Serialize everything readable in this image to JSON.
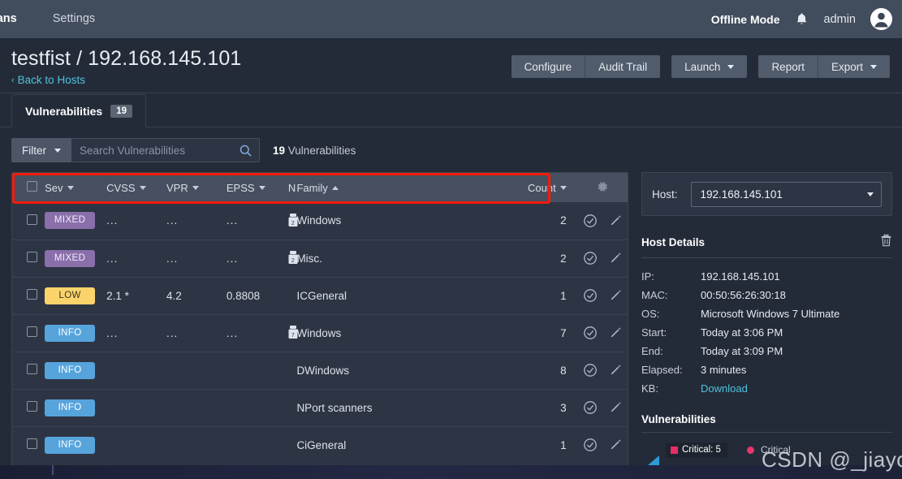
{
  "topnav": {
    "items": [
      {
        "label": "Scans",
        "active": true
      },
      {
        "label": "Settings",
        "active": false
      }
    ],
    "offline_mode": "Offline Mode",
    "bell_icon": "bell-icon",
    "user_name": "admin",
    "avatar_icon": "user-avatar-icon"
  },
  "header": {
    "title": "testfist / 192.168.145.101",
    "back_chevron": "‹",
    "back_link": "Back to Hosts",
    "buttons": {
      "configure": "Configure",
      "audit_trail": "Audit Trail",
      "launch": "Launch",
      "report": "Report",
      "export": "Export"
    }
  },
  "tabs": [
    {
      "label": "Vulnerabilities",
      "count": "19",
      "active": true
    }
  ],
  "filterbar": {
    "filter_label": "Filter",
    "search_placeholder": "Search Vulnerabilities",
    "search_value": "",
    "search_icon": "search-icon",
    "count_number": "19",
    "count_label": "Vulnerabilities"
  },
  "table": {
    "columns": [
      {
        "key": "checkbox",
        "label": "",
        "sort": ""
      },
      {
        "key": "sev",
        "label": "Sev",
        "sort": "desc"
      },
      {
        "key": "cvss",
        "label": "CVSS",
        "sort": "desc"
      },
      {
        "key": "vpr",
        "label": "VPR",
        "sort": "desc"
      },
      {
        "key": "epss",
        "label": "EPSS",
        "sort": "desc"
      },
      {
        "key": "name",
        "label": "N",
        "sort": ""
      },
      {
        "key": "family",
        "label": "Family",
        "sort": "asc"
      },
      {
        "key": "count",
        "label": "Count",
        "sort": "desc"
      },
      {
        "key": "gear",
        "label": "",
        "sort": ""
      }
    ],
    "gear_icon": "gear-icon",
    "rows": [
      {
        "sev": "MIXED",
        "sev_class": "mixed",
        "cvss": "...",
        "vpr": "...",
        "epss": "...",
        "name_badge": "2",
        "family": "Windows",
        "count": "2"
      },
      {
        "sev": "MIXED",
        "sev_class": "mixed",
        "cvss": "...",
        "vpr": "...",
        "epss": "...",
        "name_badge": "2",
        "family": "Misc.",
        "count": "2"
      },
      {
        "sev": "LOW",
        "sev_class": "low",
        "cvss": "2.1 *",
        "vpr": "4.2",
        "epss": "0.8808",
        "name_badge": "",
        "family": "ICGeneral",
        "count": "1"
      },
      {
        "sev": "INFO",
        "sev_class": "info",
        "cvss": "...",
        "vpr": "...",
        "epss": "...",
        "name_badge": "7",
        "family": "Windows",
        "count": "7"
      },
      {
        "sev": "INFO",
        "sev_class": "info",
        "cvss": "",
        "vpr": "",
        "epss": "",
        "name_badge": "",
        "family": "DWindows",
        "count": "8"
      },
      {
        "sev": "INFO",
        "sev_class": "info",
        "cvss": "",
        "vpr": "",
        "epss": "",
        "name_badge": "",
        "family": "NPort scanners",
        "count": "3"
      },
      {
        "sev": "INFO",
        "sev_class": "info",
        "cvss": "",
        "vpr": "",
        "epss": "",
        "name_badge": "",
        "family": "CiGeneral",
        "count": "1"
      }
    ],
    "row_action_icons": [
      "check-circle-icon",
      "pencil-icon"
    ]
  },
  "sidebar": {
    "host_label": "Host:",
    "host_value": "192.168.145.101",
    "host_dropdown_icon": "chevron-down-icon",
    "host_details_title": "Host Details",
    "trash_icon": "trash-icon",
    "details": [
      {
        "key": "IP:",
        "value": "192.168.145.101",
        "link": false
      },
      {
        "key": "MAC:",
        "value": "00:50:56:26:30:18",
        "link": false
      },
      {
        "key": "OS:",
        "value": "Microsoft Windows 7 Ultimate",
        "link": false
      },
      {
        "key": "Start:",
        "value": "Today at 3:06 PM",
        "link": false
      },
      {
        "key": "End:",
        "value": "Today at 3:09 PM",
        "link": false
      },
      {
        "key": "Elapsed:",
        "value": "3 minutes",
        "link": false
      },
      {
        "key": "KB:",
        "value": "Download",
        "link": true
      }
    ],
    "vulnerabilities_title": "Vulnerabilities",
    "chart_tooltip": "Critical: 5",
    "legend_label": "Critical"
  },
  "watermark": "CSDN @_jiayou",
  "chart_data": {
    "type": "pie",
    "title": "Vulnerabilities",
    "categories": [
      "Critical"
    ],
    "values": [
      5
    ],
    "labels": [
      "Critical: 5"
    ],
    "colors": [
      "#ec2b63"
    ],
    "legend_position": "right"
  },
  "colors": {
    "accent_link": "#4ec3e0",
    "severity_mixed": "#8a6fab",
    "severity_low": "#fad46b",
    "severity_info": "#57a4dc",
    "annotation_red": "#f41a0c",
    "critical": "#ec2b63",
    "page_bg": "#242b38",
    "panel_bg": "#2d3544",
    "nav_bg": "#414c5c"
  }
}
